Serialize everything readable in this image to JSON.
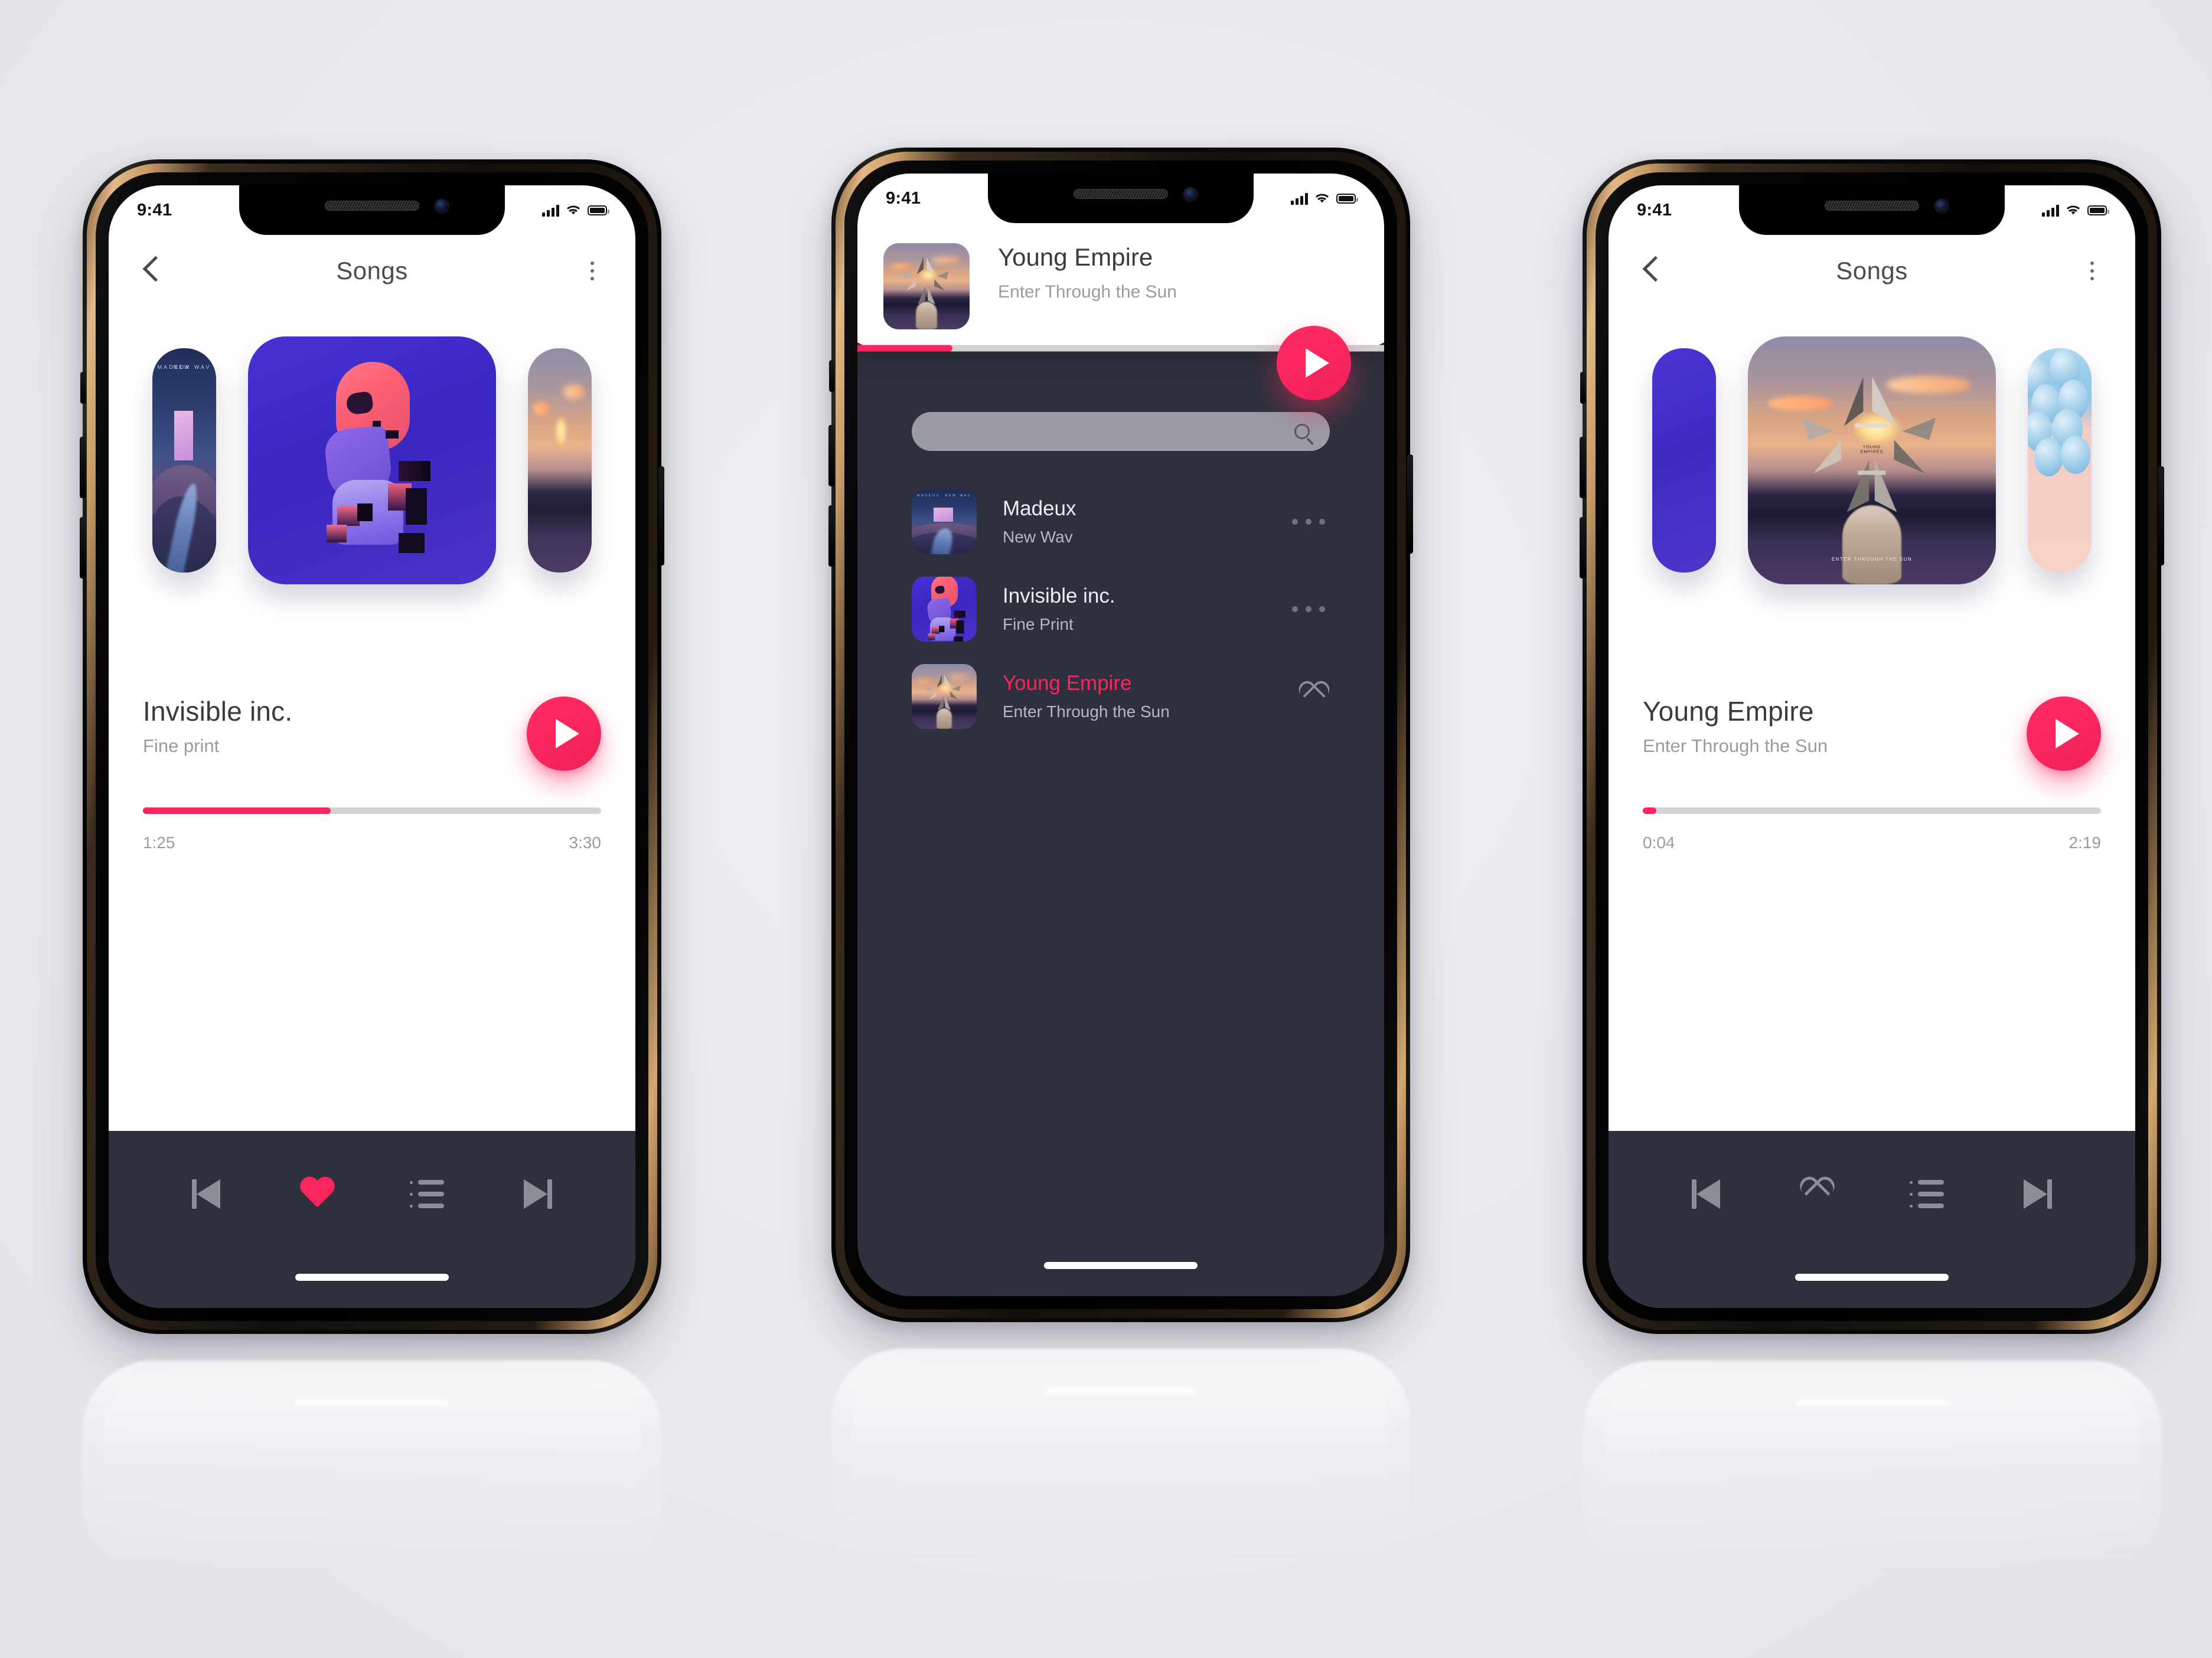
{
  "meta": {
    "accent_pink": "#F9265E",
    "dark_bg": "#2E313D",
    "page_bg": "#ECEBEF",
    "muted_text": "#9A9AA2"
  },
  "status_bar": {
    "time": "9:41",
    "signal_icon": "cellular-signal-icon",
    "wifi_icon": "wifi-icon",
    "battery_icon": "battery-full-icon"
  },
  "phone1": {
    "header": {
      "back_icon": "chevron-left-icon",
      "title": "Songs",
      "menu_icon": "more-vertical-icon"
    },
    "carousel": {
      "left_cover_alt": "New Wav album art",
      "main_cover_alt": "Fine print album art",
      "right_cover_alt": "Enter Through the Sun album art"
    },
    "now_playing": {
      "title": "Invisible inc.",
      "subtitle": "Fine print",
      "play_icon": "play-icon",
      "elapsed": "1:25",
      "duration": "3:30",
      "progress_percent": 41
    },
    "bottom_nav": {
      "prev_icon": "skip-previous-icon",
      "favorite_icon": "heart-filled-icon",
      "favorite_active": true,
      "playlist_icon": "playlist-icon",
      "next_icon": "skip-next-icon"
    }
  },
  "phone2": {
    "now_playing_card": {
      "thumb_alt": "Enter Through the Sun album art",
      "title": "Young Empire",
      "subtitle": "Enter Through the Sun",
      "play_icon": "play-icon",
      "progress_percent": 27
    },
    "search": {
      "value": "",
      "placeholder": "",
      "icon": "search-icon"
    },
    "songs": [
      {
        "title": "Madeux",
        "subtitle": "New Wav",
        "action_icon": "more-horizontal-icon",
        "active": false,
        "art": "madeux"
      },
      {
        "title": "Invisible inc.",
        "subtitle": "Fine Print",
        "action_icon": "more-horizontal-icon",
        "active": false,
        "art": "invisible"
      },
      {
        "title": "Young Empire",
        "subtitle": "Enter Through the Sun",
        "action_icon": "heart-outline-icon",
        "active": true,
        "art": "young"
      }
    ]
  },
  "phone3": {
    "header": {
      "back_icon": "chevron-left-icon",
      "title": "Songs",
      "menu_icon": "more-vertical-icon"
    },
    "carousel": {
      "left_cover_alt": "Fine print album art",
      "main_cover_alt": "Enter Through the Sun album art",
      "right_cover_alt": "Balloons album art"
    },
    "now_playing": {
      "title": "Young Empire",
      "subtitle": "Enter Through the Sun",
      "play_icon": "play-icon",
      "elapsed": "0:04",
      "duration": "2:19",
      "progress_percent": 3
    },
    "bottom_nav": {
      "prev_icon": "skip-previous-icon",
      "favorite_icon": "heart-outline-icon",
      "favorite_active": false,
      "playlist_icon": "playlist-icon",
      "next_icon": "skip-next-icon"
    }
  }
}
